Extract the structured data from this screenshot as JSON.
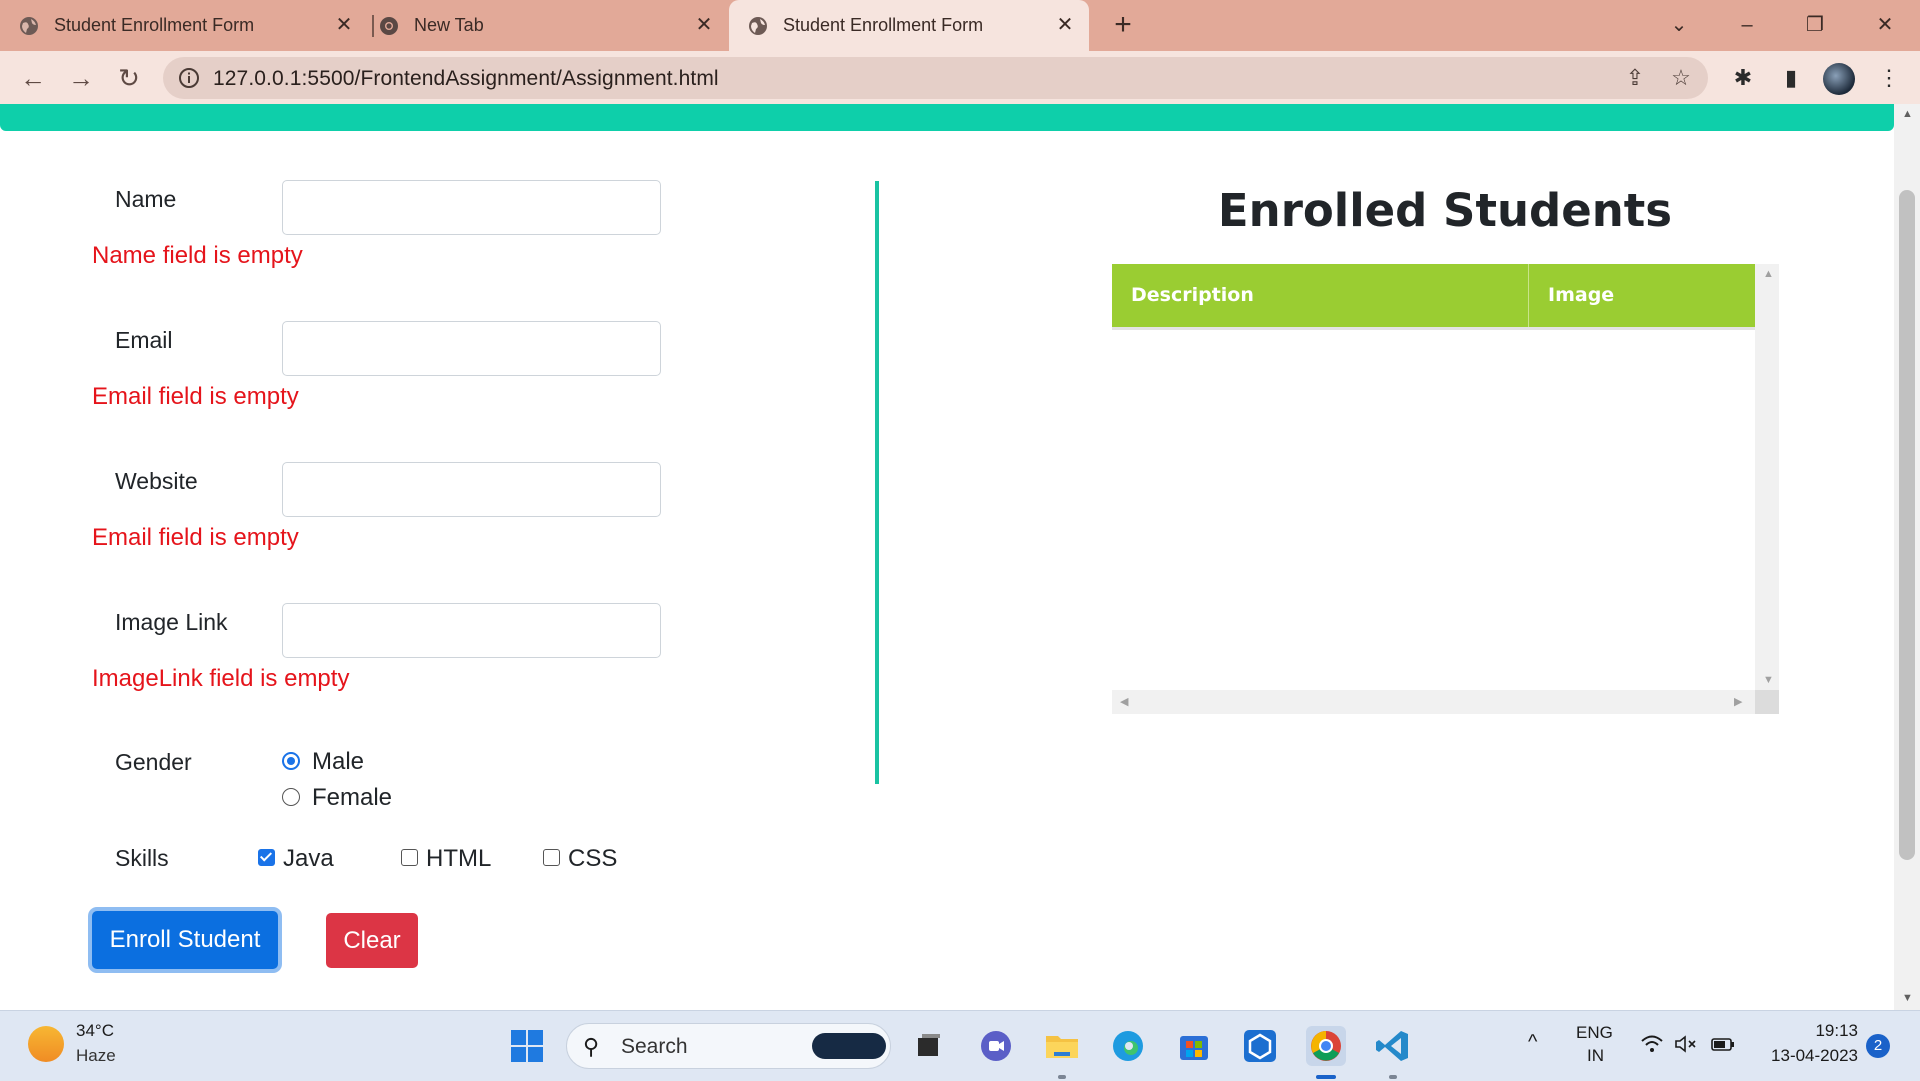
{
  "browser": {
    "tabs": [
      {
        "title": "Student Enrollment Form",
        "close": "✕"
      },
      {
        "title": "New Tab",
        "close": "✕"
      },
      {
        "title": "Student Enrollment Form",
        "close": "✕"
      }
    ],
    "new_tab": "+",
    "window_controls": {
      "tab_search": "⌄",
      "minimize": "–",
      "restore": "❐",
      "close": "✕"
    },
    "nav": {
      "back": "←",
      "forward": "→",
      "reload": "↻"
    },
    "url": "127.0.0.1:5500/FrontendAssignment/Assignment.html",
    "omnibox_icons": {
      "share": "⇪",
      "bookmark": "☆"
    },
    "toolbar_icons": {
      "extensions": "✱",
      "side_panel": "▮",
      "menu": "⋮"
    }
  },
  "form": {
    "name": {
      "label": "Name",
      "value": "",
      "error": "Name field is empty"
    },
    "email": {
      "label": "Email",
      "value": "",
      "error": "Email field is empty"
    },
    "website": {
      "label": "Website",
      "value": "",
      "error": "Email field is empty"
    },
    "image_link": {
      "label": "Image Link",
      "value": "",
      "error": "ImageLink field is empty"
    },
    "gender": {
      "label": "Gender",
      "options": [
        {
          "label": "Male",
          "checked": true
        },
        {
          "label": "Female",
          "checked": false
        }
      ]
    },
    "skills": {
      "label": "Skills",
      "options": [
        {
          "label": "Java",
          "checked": true
        },
        {
          "label": "HTML",
          "checked": false
        },
        {
          "label": "CSS",
          "checked": false
        }
      ]
    },
    "enroll_button": "Enroll Student",
    "clear_button": "Clear"
  },
  "enrolled": {
    "title": "Enrolled Students",
    "columns": [
      "Description",
      "Image"
    ],
    "rows": []
  },
  "colors": {
    "accent_bar": "#0ecfaa",
    "divider": "#19c3a2",
    "table_header": "#9acd32",
    "error_text": "#e5141b",
    "primary_button": "#0b6fe0",
    "danger_button": "#dc3545"
  },
  "taskbar": {
    "weather": {
      "temp": "34°C",
      "desc": "Haze"
    },
    "search_placeholder": "Search",
    "tray": {
      "lang1": "ENG",
      "lang2": "IN",
      "chevron": "^",
      "time": "19:13",
      "date": "13-04-2023",
      "notifications": "2"
    }
  }
}
